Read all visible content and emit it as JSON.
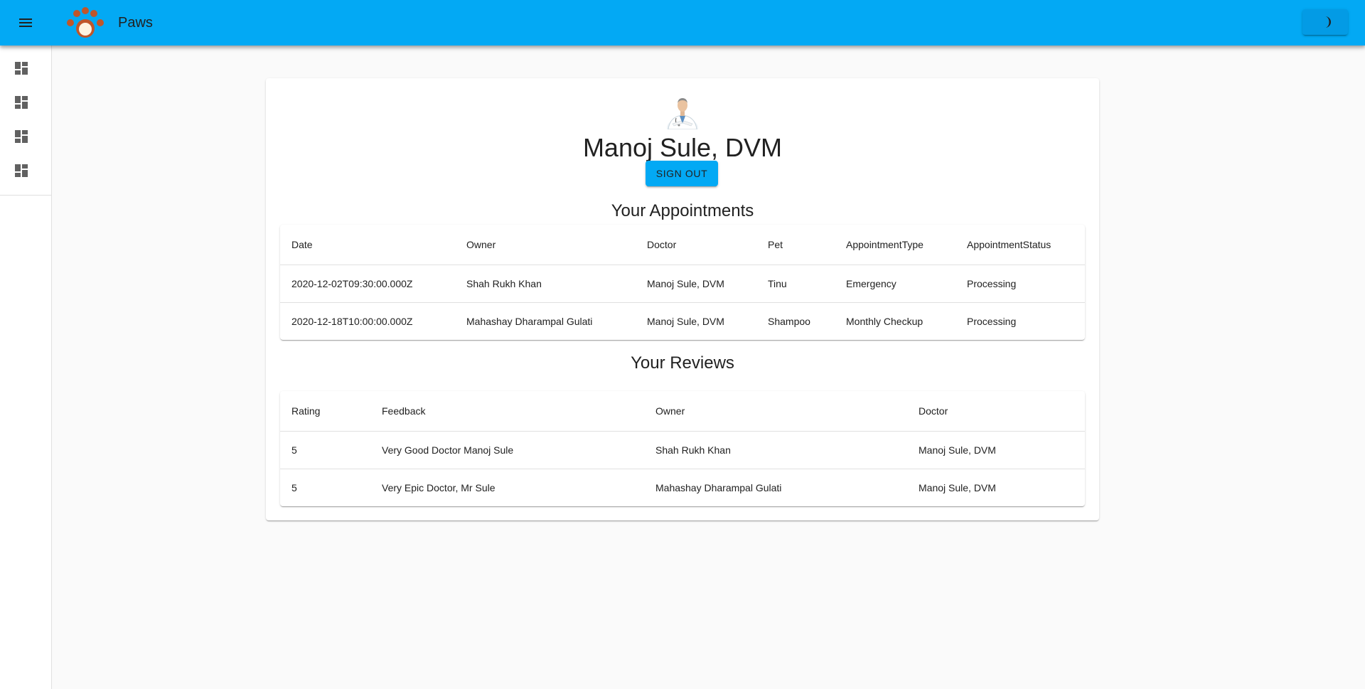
{
  "appbar": {
    "title": "Paws",
    "color": "#03a9f4"
  },
  "drawer": {
    "items": [
      {
        "icon": "dashboard-icon"
      },
      {
        "icon": "dashboard-icon"
      },
      {
        "icon": "dashboard-icon"
      },
      {
        "icon": "dashboard-icon"
      }
    ]
  },
  "profile": {
    "name": "Manoj Sule, DVM",
    "signout_label": "SIGN OUT"
  },
  "appointments": {
    "title": "Your Appointments",
    "columns": [
      "Date",
      "Owner",
      "Doctor",
      "Pet",
      "AppointmentType",
      "AppointmentStatus"
    ],
    "rows": [
      [
        "2020-12-02T09:30:00.000Z",
        "Shah Rukh Khan",
        "Manoj Sule, DVM",
        "Tinu",
        "Emergency",
        "Processing"
      ],
      [
        "2020-12-18T10:00:00.000Z",
        "Mahashay Dharampal Gulati",
        "Manoj Sule, DVM",
        "Shampoo",
        "Monthly Checkup",
        "Processing"
      ]
    ]
  },
  "reviews": {
    "title": "Your Reviews",
    "columns": [
      "Rating",
      "Feedback",
      "Owner",
      "Doctor"
    ],
    "rows": [
      [
        "5",
        "Very Good Doctor Manoj Sule",
        "Shah Rukh Khan",
        "Manoj Sule, DVM"
      ],
      [
        "5",
        "Very Epic Doctor, Mr Sule",
        "Mahashay Dharampal Gulati",
        "Manoj Sule, DVM"
      ]
    ]
  }
}
